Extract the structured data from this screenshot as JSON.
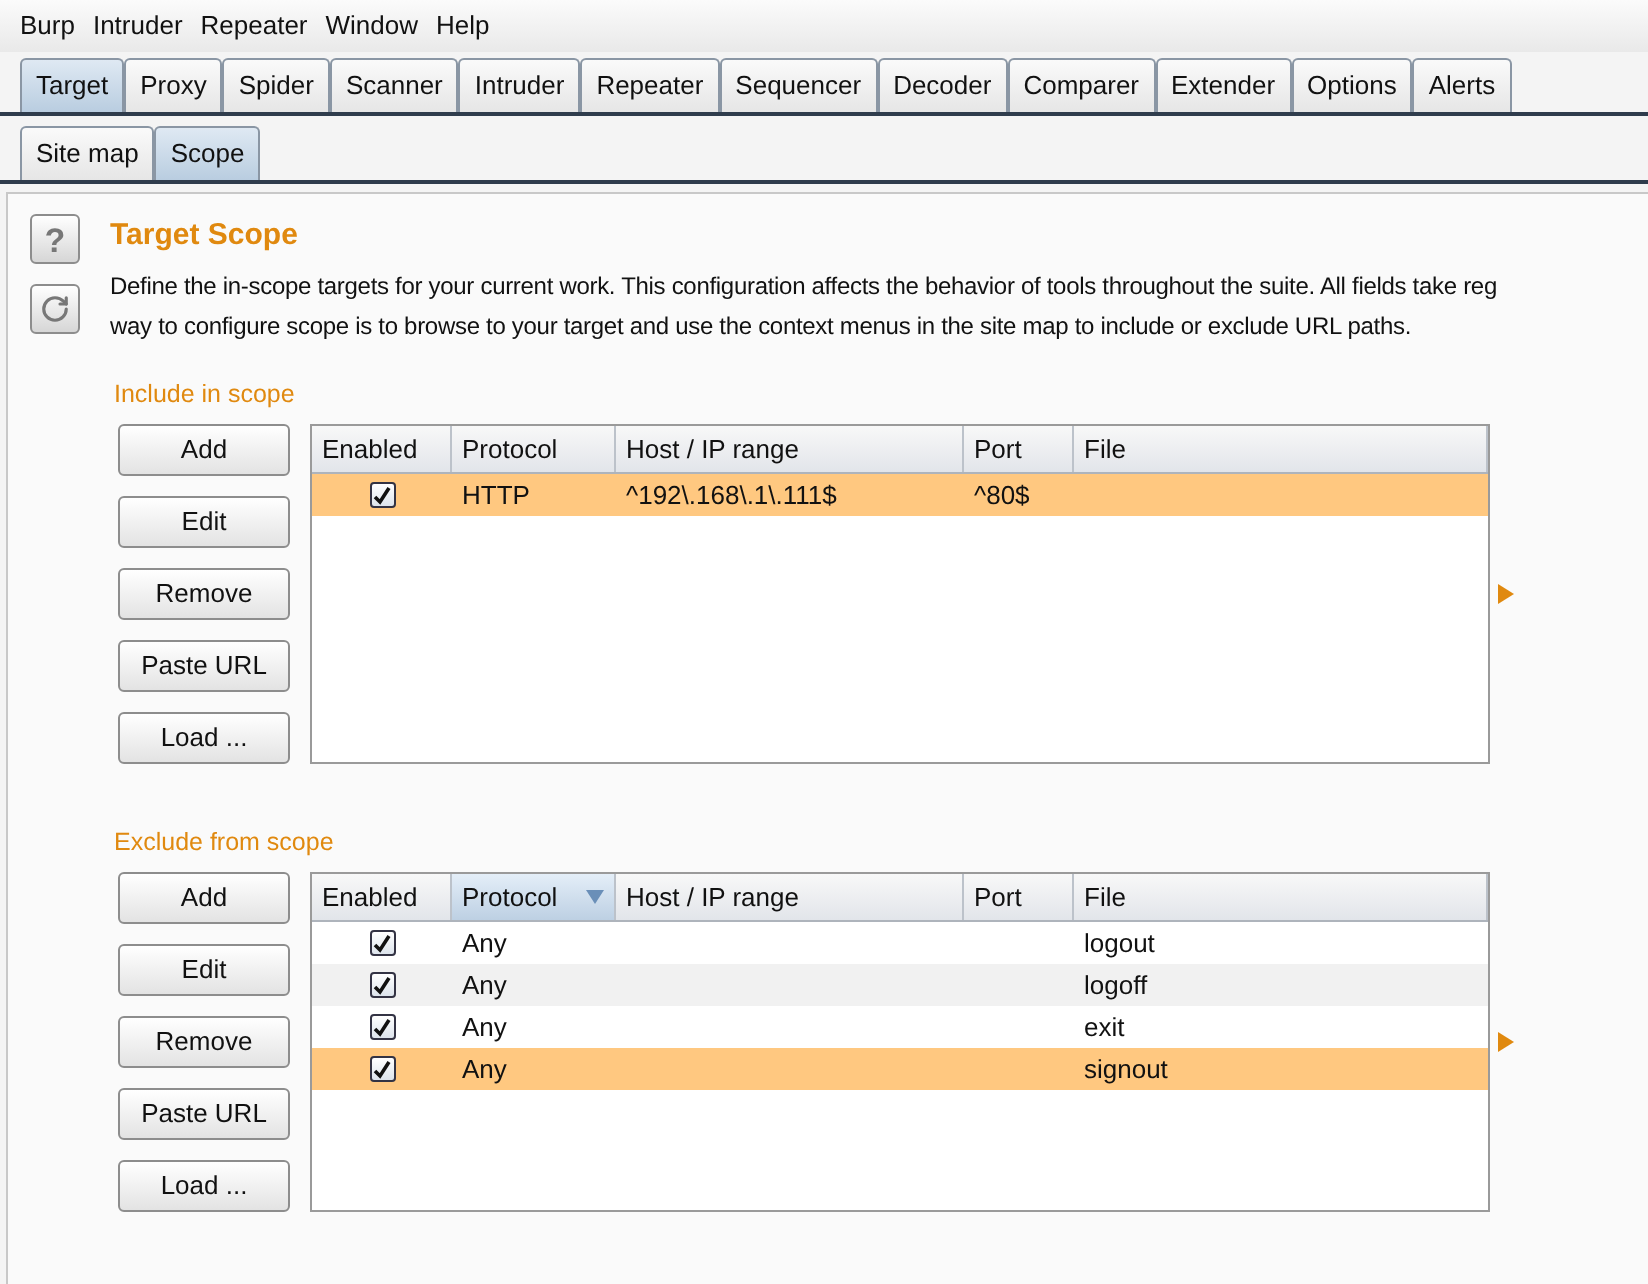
{
  "menu": [
    "Burp",
    "Intruder",
    "Repeater",
    "Window",
    "Help"
  ],
  "tabs": [
    {
      "label": "Target",
      "selected": true
    },
    {
      "label": "Proxy",
      "selected": false
    },
    {
      "label": "Spider",
      "selected": false
    },
    {
      "label": "Scanner",
      "selected": false
    },
    {
      "label": "Intruder",
      "selected": false
    },
    {
      "label": "Repeater",
      "selected": false
    },
    {
      "label": "Sequencer",
      "selected": false
    },
    {
      "label": "Decoder",
      "selected": false
    },
    {
      "label": "Comparer",
      "selected": false
    },
    {
      "label": "Extender",
      "selected": false
    },
    {
      "label": "Options",
      "selected": false
    },
    {
      "label": "Alerts",
      "selected": false
    }
  ],
  "subtabs": [
    {
      "label": "Site map",
      "selected": false
    },
    {
      "label": "Scope",
      "selected": true
    }
  ],
  "help_button": "?",
  "title": "Target Scope",
  "description": [
    "Define the in-scope targets for your current work. This configuration affects the behavior of tools throughout the suite. All fields take reg",
    "way to configure scope is to browse to your target and use the context menus in the site map to include or exclude URL paths."
  ],
  "sections": [
    {
      "heading": "Include in scope",
      "buttons": [
        "Add",
        "Edit",
        "Remove",
        "Paste URL",
        "Load ..."
      ],
      "columns": [
        {
          "label": "Enabled",
          "selected": false
        },
        {
          "label": "Protocol",
          "selected": false
        },
        {
          "label": "Host / IP range",
          "selected": false
        },
        {
          "label": "Port",
          "selected": false
        },
        {
          "label": "File",
          "selected": false
        }
      ],
      "rows": [
        {
          "enabled": true,
          "selected": true,
          "protocol": "HTTP",
          "host": "^192\\.168\\.1\\.111$",
          "port": "^80$",
          "file": ""
        }
      ]
    },
    {
      "heading": "Exclude from scope",
      "buttons": [
        "Add",
        "Edit",
        "Remove",
        "Paste URL",
        "Load ..."
      ],
      "columns": [
        {
          "label": "Enabled",
          "selected": false
        },
        {
          "label": "Protocol",
          "selected": true
        },
        {
          "label": "Host / IP range",
          "selected": false
        },
        {
          "label": "Port",
          "selected": false
        },
        {
          "label": "File",
          "selected": false
        }
      ],
      "rows": [
        {
          "enabled": true,
          "selected": false,
          "protocol": "Any",
          "host": "",
          "port": "",
          "file": "logout"
        },
        {
          "enabled": true,
          "selected": false,
          "protocol": "Any",
          "host": "",
          "port": "",
          "file": "logoff"
        },
        {
          "enabled": true,
          "selected": false,
          "protocol": "Any",
          "host": "",
          "port": "",
          "file": "exit"
        },
        {
          "enabled": true,
          "selected": true,
          "protocol": "Any",
          "host": "",
          "port": "",
          "file": "signout"
        }
      ]
    }
  ]
}
